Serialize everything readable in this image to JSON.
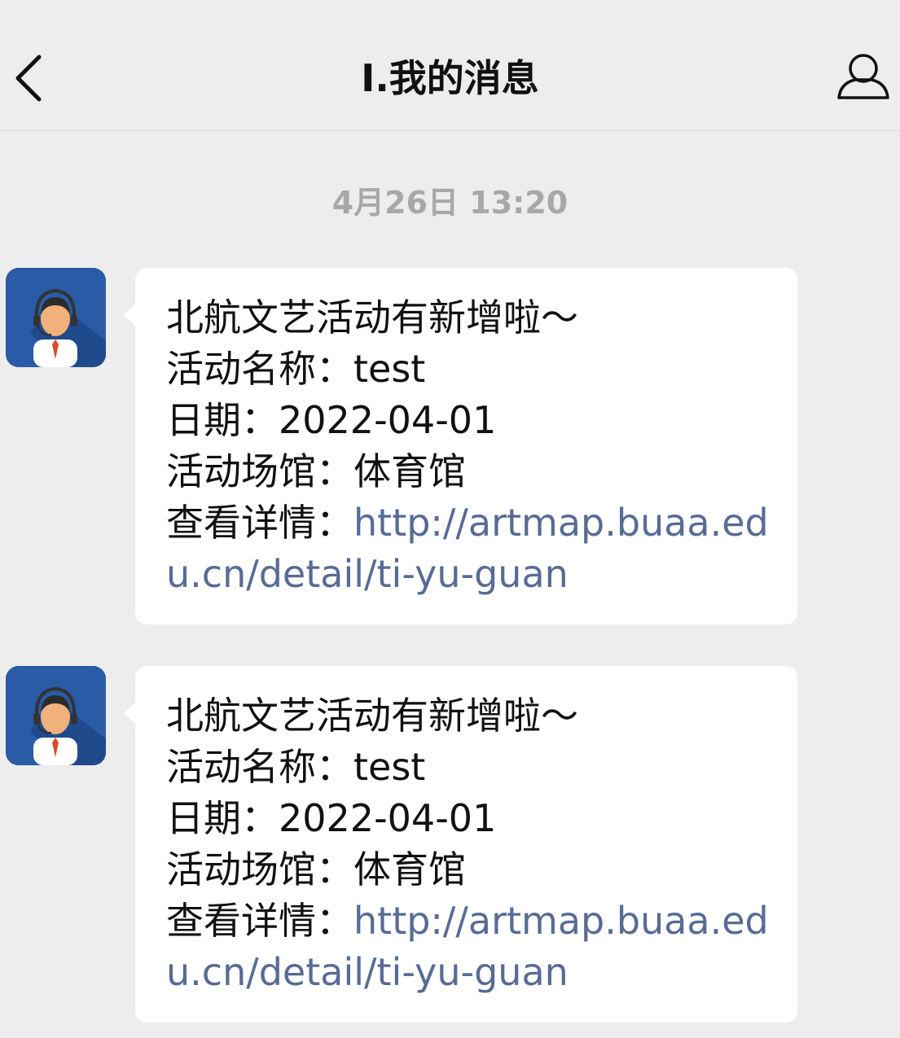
{
  "header": {
    "title": "I.我的消息"
  },
  "timestamp": "4月26日 13:20",
  "messages": [
    {
      "line1": "北航文艺活动有新增啦～",
      "name_label": "活动名称：",
      "name_value": "test",
      "date_label": "日期：",
      "date_value": "2022-04-01",
      "venue_label": "活动场馆：",
      "venue_value": "体育馆",
      "detail_label": "查看详情：",
      "detail_link": "http://artmap.buaa.edu.cn/detail/ti-yu-guan"
    },
    {
      "line1": "北航文艺活动有新增啦～",
      "name_label": "活动名称：",
      "name_value": "test",
      "date_label": "日期：",
      "date_value": "2022-04-01",
      "venue_label": "活动场馆：",
      "venue_value": "体育馆",
      "detail_label": "查看详情：",
      "detail_link": "http://artmap.buaa.edu.cn/detail/ti-yu-guan"
    }
  ],
  "colors": {
    "background": "#ededed",
    "link": "#576b95",
    "avatar_blue": "#2a5ba7"
  },
  "icons": {
    "back": "chevron-left-icon",
    "profile": "person-icon",
    "avatar": "customer-service-avatar"
  }
}
